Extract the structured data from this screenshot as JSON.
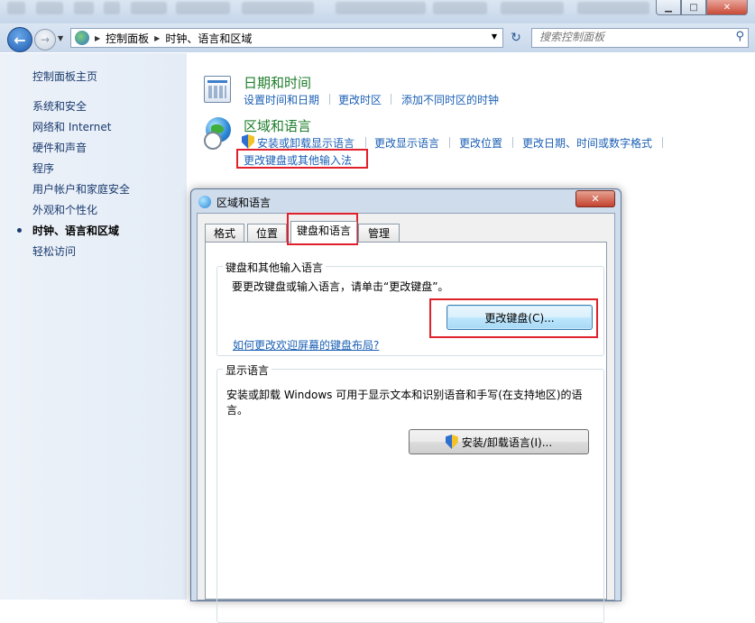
{
  "window": {
    "controls": {
      "minimize": "▁",
      "maximize": "□",
      "close": "✕"
    }
  },
  "nav": {
    "back_icon": "arrow-left-icon",
    "forward_icon": "arrow-right-icon",
    "breadcrumb": [
      "控制面板",
      "时钟、语言和区域"
    ],
    "search_placeholder": "搜索控制面板"
  },
  "sidebar": {
    "home": "控制面板主页",
    "items": [
      "系统和安全",
      "网络和 Internet",
      "硬件和声音",
      "程序",
      "用户帐户和家庭安全",
      "外观和个性化",
      "时钟、语言和区域",
      "轻松访问"
    ],
    "active_index": 6
  },
  "main": {
    "datetime": {
      "title": "日期和时间",
      "links": [
        "设置时间和日期",
        "更改时区",
        "添加不同时区的时钟"
      ]
    },
    "region": {
      "title": "区域和语言",
      "links": [
        "安装或卸载显示语言",
        "更改显示语言",
        "更改位置",
        "更改日期、时间或数字格式",
        "更改键盘或其他输入法"
      ]
    }
  },
  "dialog": {
    "title": "区域和语言",
    "close": "✕",
    "tabs": [
      "格式",
      "位置",
      "键盘和语言",
      "管理"
    ],
    "active_tab": 2,
    "keyboard_group": {
      "label": "键盘和其他输入语言",
      "text": "要更改键盘或输入语言，请单击“更改键盘”。",
      "button": "更改键盘(C)...",
      "link": "如何更改欢迎屏幕的键盘布局?"
    },
    "display_group": {
      "label": "显示语言",
      "text_line1": "安装或卸载 Windows 可用于显示文本和识别语音和手写(在支持地区)的语",
      "text_line2": "言。",
      "button": "安装/卸载语言(I)..."
    }
  }
}
